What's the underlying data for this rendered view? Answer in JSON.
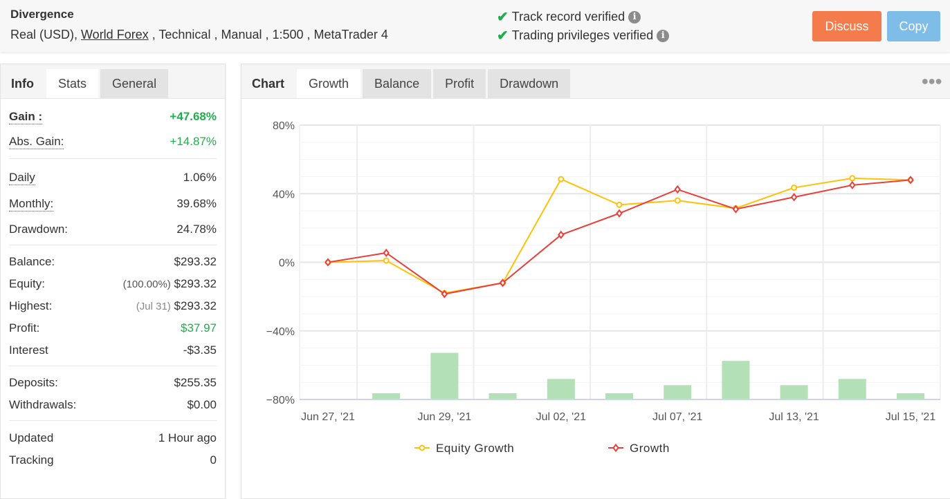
{
  "header": {
    "title": "Divergence",
    "subtitle_pre": "Real (USD), ",
    "broker": "World Forex",
    "subtitle_post": " , Technical , Manual , 1:500 , MetaTrader 4",
    "verifications": [
      "Track record verified",
      "Trading privileges verified"
    ],
    "discuss": "Discuss",
    "copy": "Copy",
    "colors": {
      "discuss": "#f47b4c",
      "copy": "#7dbde8",
      "check": "#1fae4b"
    }
  },
  "left_tabs": [
    "Info",
    "Stats",
    "General"
  ],
  "stats": {
    "gain": {
      "label": "Gain :",
      "value": "+47.68%"
    },
    "abs_gain": {
      "label": "Abs. Gain:",
      "value": "+14.87%"
    },
    "daily": {
      "label": "Daily",
      "value": "1.06%"
    },
    "monthly": {
      "label": "Monthly:",
      "value": "39.68%"
    },
    "drawdown": {
      "label": "Drawdown:",
      "value": "24.78%"
    },
    "balance": {
      "label": "Balance:",
      "value": "$293.32"
    },
    "equity": {
      "label": "Equity:",
      "note": "(100.00%)",
      "value": "$293.32"
    },
    "highest": {
      "label": "Highest:",
      "note": "(Jul 31)",
      "value": "$293.32"
    },
    "profit": {
      "label": "Profit:",
      "value": "$37.97"
    },
    "interest": {
      "label": "Interest",
      "value": "-$3.35"
    },
    "deposits": {
      "label": "Deposits:",
      "value": "$255.35"
    },
    "withdrawals": {
      "label": "Withdrawals:",
      "value": "$0.00"
    },
    "updated": {
      "label": "Updated",
      "value": "1 Hour ago"
    },
    "tracking": {
      "label": "Tracking",
      "value": "0"
    }
  },
  "chart_tabs": [
    "Chart",
    "Growth",
    "Balance",
    "Profit",
    "Drawdown"
  ],
  "chart_data": {
    "type": "line",
    "x_tick_labels": [
      "Jun 27, '21",
      "Jun 29, '21",
      "Jul 02, '21",
      "Jul 07, '21",
      "Jul 13, '21",
      "Jul 15, '21"
    ],
    "y_tick_labels": [
      "80%",
      "40%",
      "0%",
      "−40%",
      "−80%"
    ],
    "ylim": [
      -80,
      80
    ],
    "grid": true,
    "legend": "bottom",
    "series": [
      {
        "name": "Equity Growth",
        "color": "#ffc107",
        "marker": "circle",
        "values": [
          0,
          1,
          -18,
          -12,
          48.5,
          33.5,
          36,
          31.5,
          43.5,
          49,
          48
        ]
      },
      {
        "name": "Growth",
        "color": "#e8413c",
        "marker": "diamond",
        "values": [
          0,
          5.5,
          -18.5,
          -12,
          16,
          28.5,
          42.5,
          31,
          38,
          45,
          48
        ]
      }
    ],
    "bars": {
      "color": "#b3e0b7",
      "values": [
        0,
        1,
        7.5,
        1,
        3.3,
        1,
        2.3,
        6.2,
        2.3,
        3.3,
        1
      ]
    }
  }
}
